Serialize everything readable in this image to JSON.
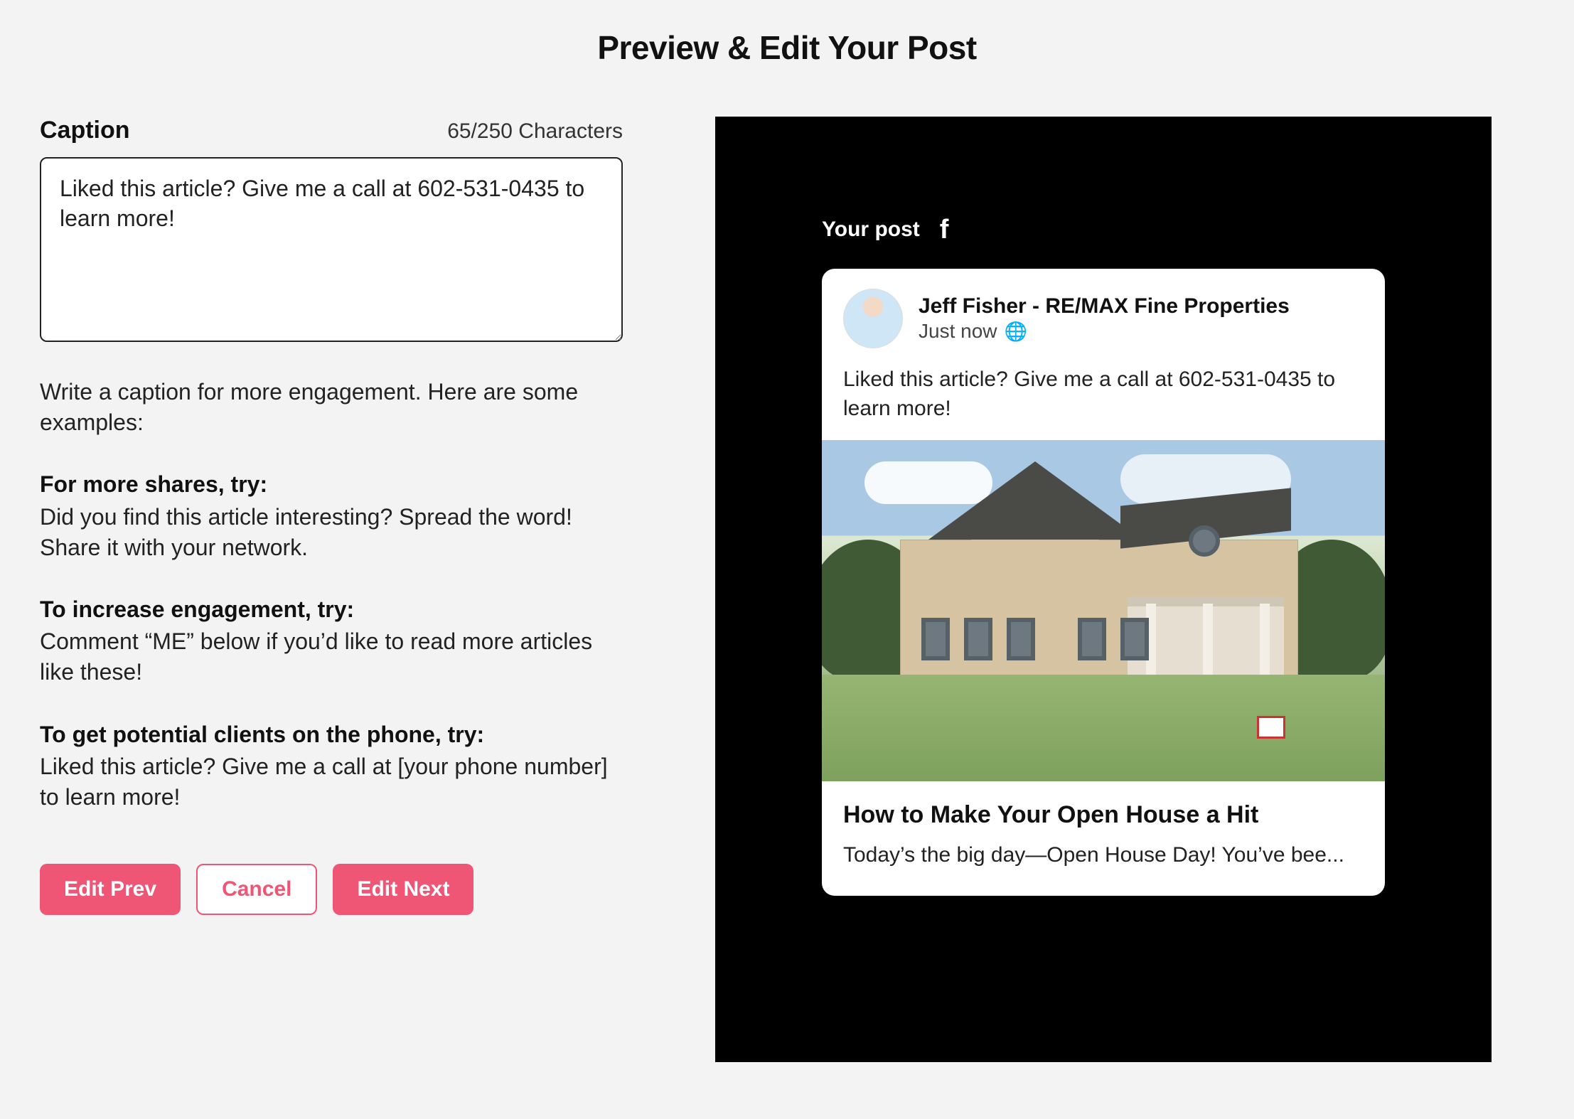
{
  "page": {
    "title": "Preview & Edit Your Post"
  },
  "caption": {
    "label": "Caption",
    "char_count": "65/250 Characters",
    "value": "Liked this article? Give me a call at 602-531-0435 to learn more!",
    "help": "Write a caption for more engagement. Here are some examples:",
    "tips": [
      {
        "head": "For more shares, try:",
        "body": "Did you find this article interesting? Spread the word! Share it with your network."
      },
      {
        "head": "To increase engagement, try:",
        "body": "Comment “ME” below if you’d like to read more articles like these!"
      },
      {
        "head": "To get potential clients on the phone, try:",
        "body": "Liked this article? Give me a call at [your phone number] to learn more!"
      }
    ]
  },
  "buttons": {
    "prev": "Edit Prev",
    "cancel": "Cancel",
    "next": "Edit Next"
  },
  "preview": {
    "label": "Your post",
    "network_icon": "facebook-icon",
    "author": "Jeff Fisher - RE/MAX Fine Properties",
    "time": "Just now",
    "visibility_icon": "globe-icon",
    "caption": "Liked this article? Give me a call at 602-531-0435 to learn more!",
    "article_title": "How to Make Your Open House a Hit",
    "article_excerpt": "Today’s the big day—Open House Day! You’ve bee..."
  }
}
